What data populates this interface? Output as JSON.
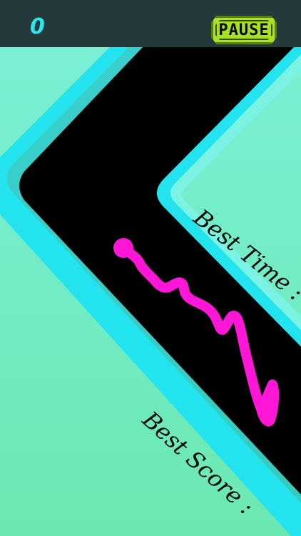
{
  "hud": {
    "score": "0",
    "pause_label": "PAUSE"
  },
  "stats": {
    "best_time_label": "Best Time :",
    "best_score_label": "Best Score :"
  },
  "colors": {
    "background": "#76eed0",
    "track": "#000000",
    "track_border": "#22e3ee",
    "snake": "#ff16d6",
    "pause_button": "#a7e32b",
    "top_bar": "#243a3a"
  },
  "icons": {
    "player": "snake-head-ball"
  }
}
